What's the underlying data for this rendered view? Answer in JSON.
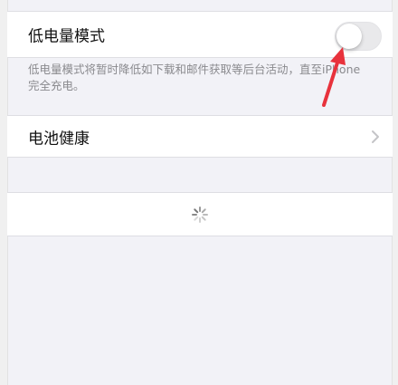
{
  "low_power_mode": {
    "label": "低电量模式",
    "enabled": false,
    "description": "低电量模式将暂时降低如下载和邮件获取等后台活动，直至iPhone完全充电。"
  },
  "battery_health": {
    "label": "电池健康"
  },
  "loading": {
    "icon": "activity-spinner-icon"
  },
  "annotation": {
    "icon": "red-arrow-icon",
    "color": "#e8323c"
  },
  "colors": {
    "background": "#f2f2f7",
    "toggle_off": "#e9e9eb",
    "footer_text": "#8a8a8e",
    "chevron": "#c4c4c7"
  }
}
